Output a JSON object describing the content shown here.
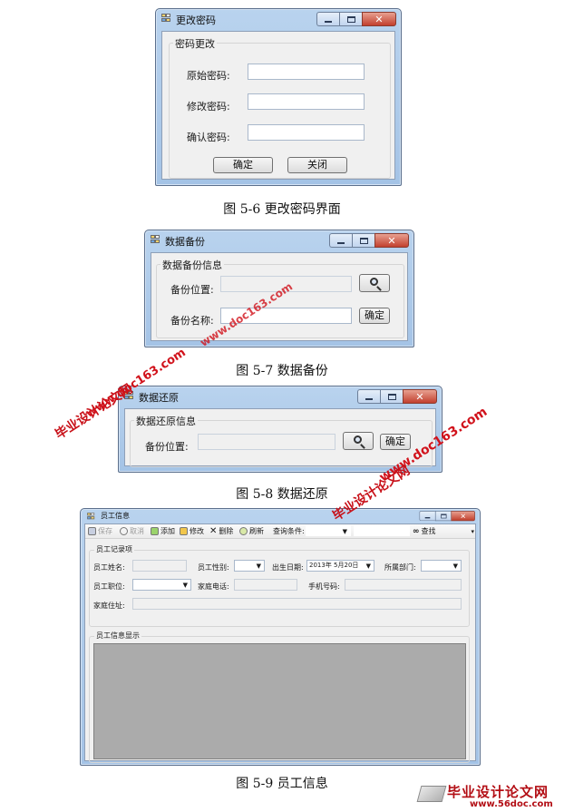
{
  "pwd_window": {
    "title": "更改密码",
    "group": "密码更改",
    "labels": [
      "原始密码:",
      "修改密码:",
      "确认密码:"
    ],
    "ok": "确定",
    "close": "关闭"
  },
  "caption1": "图 5-6 更改密码界面",
  "backup_window": {
    "title": "数据备份",
    "group": "数据备份信息",
    "location_label": "备份位置:",
    "name_label": "备份名称:",
    "ok": "确定"
  },
  "caption2": "图 5-7 数据备份",
  "restore_window": {
    "title": "数据还原",
    "group": "数据还原信息",
    "location_label": "备份位置:",
    "ok": "确定"
  },
  "caption3": "图 5-8 数据还原",
  "emp_window": {
    "title": "员工信息",
    "toolbar": {
      "save": "保存",
      "cancel": "取消",
      "add": "添加",
      "edit": "修改",
      "delete": "删除",
      "refresh": "刷新",
      "query_label": "查询条件:",
      "find": "查找"
    },
    "record_group": "员工记录项",
    "name_label": "员工姓名:",
    "gender_label": "员工性别:",
    "birth_label": "出生日期:",
    "birth_value": "2013年 5月20日",
    "dept_label": "所属部门:",
    "position_label": "员工职位:",
    "home_phone_label": "家庭电话:",
    "mobile_label": "手机号码:",
    "address_label": "家庭住址:",
    "display_group": "员工信息显示"
  },
  "caption4": "图 5-9 员工信息",
  "watermarks": {
    "site_cn": "毕业设计论文网",
    "url": "www.doc163.com",
    "footer_cn": "毕业设计论文网",
    "footer_url": "www.56doc.com"
  },
  "colors": {
    "accent": "#d1121b",
    "title_bar": "#b9d3ee",
    "close_button": "#c2402e"
  }
}
